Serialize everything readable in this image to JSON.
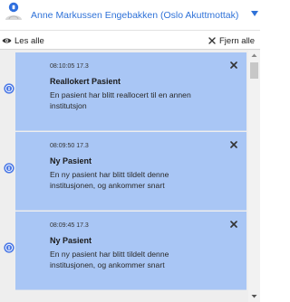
{
  "user": {
    "name": "Anne Markussen Engebakken (Oslo Akuttmottak)",
    "avatar_icon": "user-avatar-icon",
    "chevron_icon": "chevron-down-icon"
  },
  "toolbar": {
    "read_all_label": "Les alle",
    "read_all_icon": "eye-icon",
    "clear_all_label": "Fjern alle",
    "clear_all_icon": "close-icon"
  },
  "notifications": [
    {
      "time": "08:10:05 17.3",
      "title": "Reallokert Pasient",
      "message": "En pasient har blitt reallocert til en annen institutsjon"
    },
    {
      "time": "08:09:50 17.3",
      "title": "Ny Pasient",
      "message": "En ny pasient har blitt tildelt denne institusjonen, og ankommer snart"
    },
    {
      "time": "08:09:45 17.3",
      "title": "Ny Pasient",
      "message": "En ny pasient har blitt tildelt denne institusjonen, og ankommer snart"
    }
  ],
  "colors": {
    "link_blue": "#2f72d8",
    "card_bg": "#a9c6f5",
    "panel_bg": "#eeeeee",
    "info_icon": "#4a78e6"
  }
}
